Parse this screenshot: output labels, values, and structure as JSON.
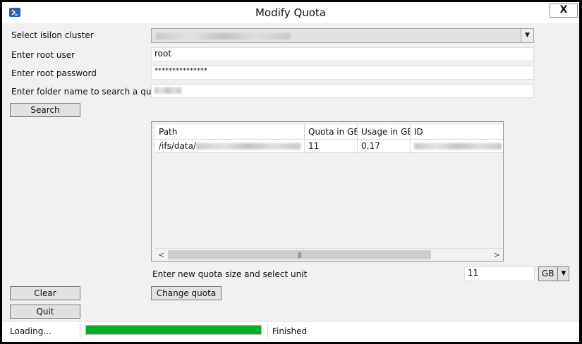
{
  "window": {
    "title": "Modify Quota",
    "close_label": "X",
    "app_icon": "powershell-icon"
  },
  "form": {
    "cluster_label": "Select isilon cluster",
    "user_label": "Enter root user",
    "user_value": "root",
    "password_label": "Enter root password",
    "password_value": "***************",
    "folder_label": "Enter folder name to search a quota"
  },
  "buttons": {
    "search": "Search",
    "clear": "Clear",
    "quit": "Quit",
    "change_quota": "Change quota"
  },
  "grid": {
    "columns": [
      "Path",
      "Quota in GB",
      "Usage in GB",
      "ID"
    ],
    "rows": [
      {
        "path": "/ifs/data/",
        "quota": "11",
        "usage": "0,17"
      }
    ]
  },
  "new_quota": {
    "label": "Enter new quota size and select unit",
    "value": "11",
    "unit": "GB"
  },
  "status": {
    "left": "Loading...",
    "progress": 1.0,
    "right": "Finished",
    "progress_color": "#06b025"
  }
}
